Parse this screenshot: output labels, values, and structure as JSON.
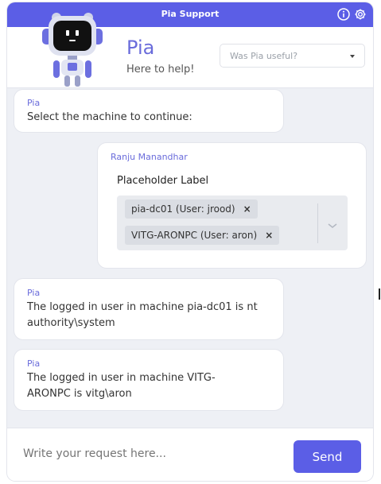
{
  "app": {
    "title": "Pia Support"
  },
  "header": {
    "bot_name": "Pia",
    "bot_subtitle": "Here to help!",
    "feedback_placeholder": "Was Pia useful?"
  },
  "messages": [
    {
      "sender": "Pia",
      "lines": [
        "Select the machine to continue:"
      ]
    },
    {
      "sender": "Pia",
      "lines": [
        "The logged in user in machine pia-dc01 is nt",
        "authority\\system"
      ]
    },
    {
      "sender": "Pia",
      "lines": [
        "The logged in user in machine VITG-",
        "ARONPC is vitg\\aron"
      ]
    }
  ],
  "user_reply": {
    "sender": "Ranju Manandhar",
    "field_label": "Placeholder Label",
    "selected": [
      {
        "label": "pia-dc01 (User: jrood)",
        "remove": "×"
      },
      {
        "label": "VITG-ARONPC (User: aron)",
        "remove": "×"
      }
    ]
  },
  "composer": {
    "placeholder": "Write your request here...",
    "send_label": "Send"
  },
  "colors": {
    "accent": "#5b5ee6",
    "sender": "#6a6cdb",
    "panel_bg": "#eef0f5"
  },
  "icons": {
    "info": "info-icon",
    "settings": "gear-icon",
    "robot": "robot-avatar"
  }
}
